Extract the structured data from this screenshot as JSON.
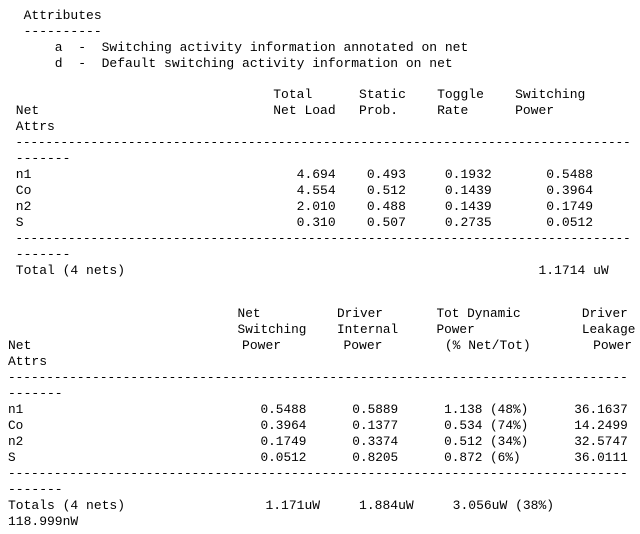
{
  "attributes_section": {
    "lines": [
      "  Attributes",
      "  ----------",
      "      a  -  Switching activity information annotated on net",
      "      d  -  Default switching activity information on net"
    ]
  },
  "net_table": {
    "lines": [
      "                                  Total      Static    Toggle    Switching",
      " Net                              Net Load   Prob.     Rate      Power",
      " Attrs",
      " ----------------------------------------------------------------------------------",
      " -------",
      " n1                                  4.694    0.493     0.1932       0.5488",
      " Co                                  4.554    0.512     0.1439       0.3964",
      " n2                                  2.010    0.488     0.1439       0.1749",
      " S                                   0.310    0.507     0.2735       0.0512",
      " ----------------------------------------------------------------------------------",
      " -------",
      " Total (4 nets)                                                     1.1714 uW"
    ]
  },
  "power_table": {
    "lines": [
      "                              Net          Driver       Tot Dynamic        Driver",
      "                              Switching    Internal     Power              Leakage",
      "Net                           Power        Power        (% Net/Tot)        Power",
      "Attrs",
      "---------------------------------------------------------------------------------",
      "-------",
      "n1                               0.5488      0.5889      1.138 (48%)      36.1637",
      "Co                               0.3964      0.1377      0.534 (74%)      14.2499",
      "n2                               0.1749      0.3374      0.512 (34%)      32.5747",
      "S                                0.0512      0.8205      0.872 (6%)       36.0111",
      "---------------------------------------------------------------------------------",
      "-------",
      "Totals (4 nets)                  1.171uW     1.884uW     3.056uW (38%)",
      "118.999nW"
    ]
  }
}
